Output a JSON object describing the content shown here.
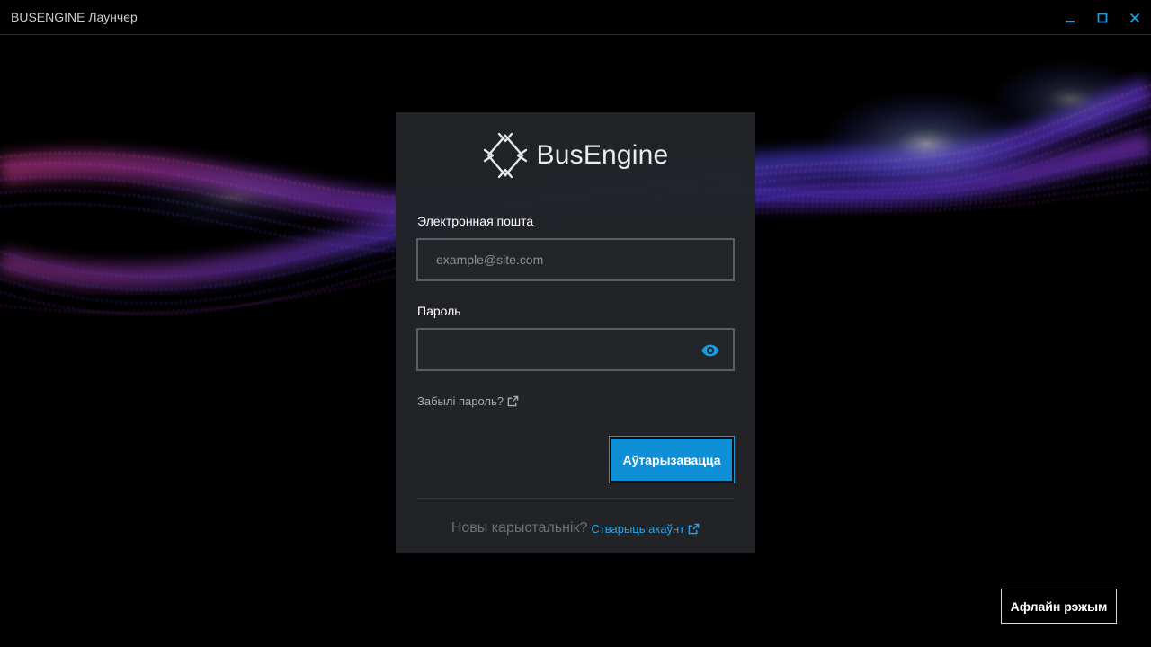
{
  "window": {
    "title": "BUSENGINE Лаунчер",
    "controls": [
      "minimize-icon",
      "maximize-icon",
      "close-icon"
    ],
    "control_color": "#1e9be4"
  },
  "login": {
    "brand": "BusEngine",
    "email_label": "Электронная пошта",
    "email_placeholder": "example@site.com",
    "email_value": "",
    "password_label": "Пароль",
    "password_value": "",
    "show_password_icon": "eye-icon",
    "forgot_password": "Забылі пароль?",
    "forgot_icon": "external-link-icon",
    "submit_label": "Аўтарызавацца",
    "new_user_question": "Новы карыстальнік?",
    "create_account": "Стварыць акаўнт",
    "accent_color": "#0f8fd6"
  },
  "footer": {
    "offline_mode": "Афлайн рэжым"
  }
}
